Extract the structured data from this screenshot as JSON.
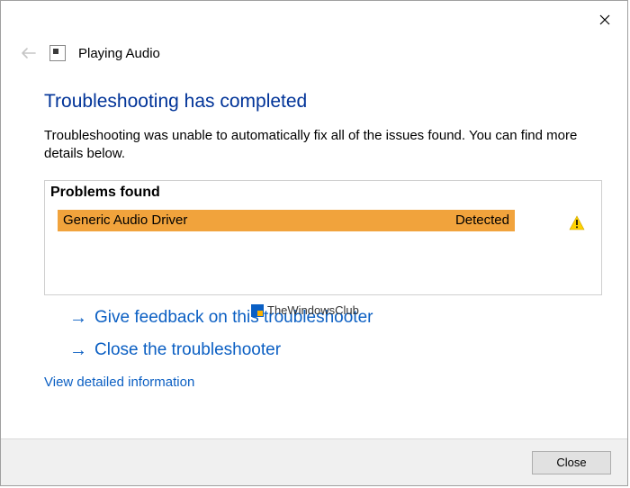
{
  "window": {
    "title": "Playing Audio"
  },
  "main": {
    "heading": "Troubleshooting has completed",
    "description": "Troubleshooting was unable to automatically fix all of the issues found. You can find more details below."
  },
  "problems": {
    "heading": "Problems found",
    "items": [
      {
        "name": "Generic Audio Driver",
        "status": "Detected"
      }
    ]
  },
  "actions": {
    "feedback": "Give feedback on this troubleshooter",
    "close_ts": "Close the troubleshooter",
    "details": "View detailed information"
  },
  "footer": {
    "close": "Close"
  },
  "watermark": "TheWindowsClub"
}
